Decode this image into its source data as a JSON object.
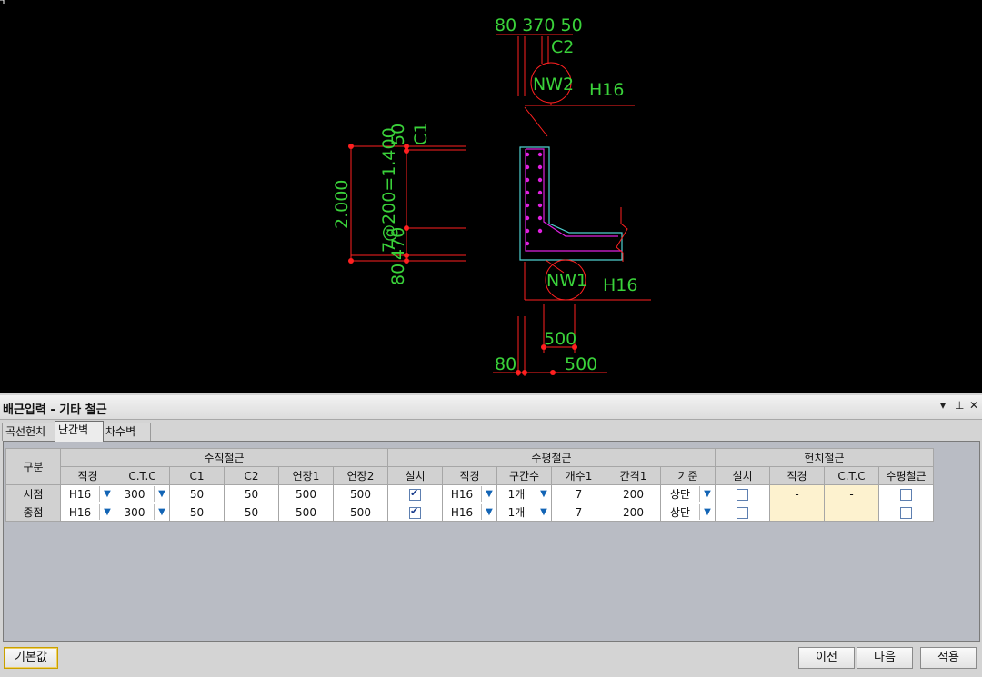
{
  "drawing": {
    "dim_top": "80 370 50",
    "label_c2": "C2",
    "label_c1": "C1",
    "label_nw2": "NW2",
    "label_nw1": "NW1",
    "label_h16_top": "H16",
    "label_h16_bottom": "H16",
    "dim_vert_height": "2.000",
    "dim_vert_spacing": "7@200=1.400",
    "dim_vert_50": "50",
    "dim_vert_470": "470",
    "dim_vert_80": "80",
    "dim_500_upper": "500",
    "dim_80_bottom": "80",
    "dim_500_lower": "500"
  },
  "panel": {
    "title": "배근입력 - 기타 철근",
    "controls": [
      "▾",
      "⊥",
      "✕"
    ],
    "tabs": [
      "곡선헌치",
      "난간벽",
      "차수벽"
    ],
    "active_tab": 1
  },
  "grid": {
    "group_headers": [
      "구분",
      "수직철근",
      "수평철근",
      "헌치철근"
    ],
    "col_headers": [
      "직경",
      "C.T.C",
      "C1",
      "C2",
      "연장1",
      "연장2",
      "설치",
      "직경",
      "구간수",
      "개수1",
      "간격1",
      "기준",
      "설치",
      "직경",
      "C.T.C",
      "수평철근"
    ],
    "rows": [
      {
        "name": "시점",
        "v_dia": "H16",
        "v_ctc": "300",
        "c1": "50",
        "c2": "50",
        "ext1": "500",
        "ext2": "500",
        "h_install": true,
        "h_dia": "H16",
        "h_sections": "1개",
        "h_count1": "7",
        "h_spacing1": "200",
        "h_base": "상단",
        "hc_install": false,
        "hc_dia": "-",
        "hc_ctc": "-",
        "hc_horiz": false
      },
      {
        "name": "종점",
        "v_dia": "H16",
        "v_ctc": "300",
        "c1": "50",
        "c2": "50",
        "ext1": "500",
        "ext2": "500",
        "h_install": true,
        "h_dia": "H16",
        "h_sections": "1개",
        "h_count1": "7",
        "h_spacing1": "200",
        "h_base": "상단",
        "hc_install": false,
        "hc_dia": "-",
        "hc_ctc": "-",
        "hc_horiz": false
      }
    ]
  },
  "buttons": {
    "default": "기본값",
    "prev": "이전",
    "next": "다음",
    "apply": "적용"
  },
  "colors": {
    "cad_bg": "#000000",
    "dim_text": "#3ad23a",
    "dim_line": "#ff2020",
    "section_outline": "#4fd0d0",
    "rebar": "#e020e0"
  }
}
